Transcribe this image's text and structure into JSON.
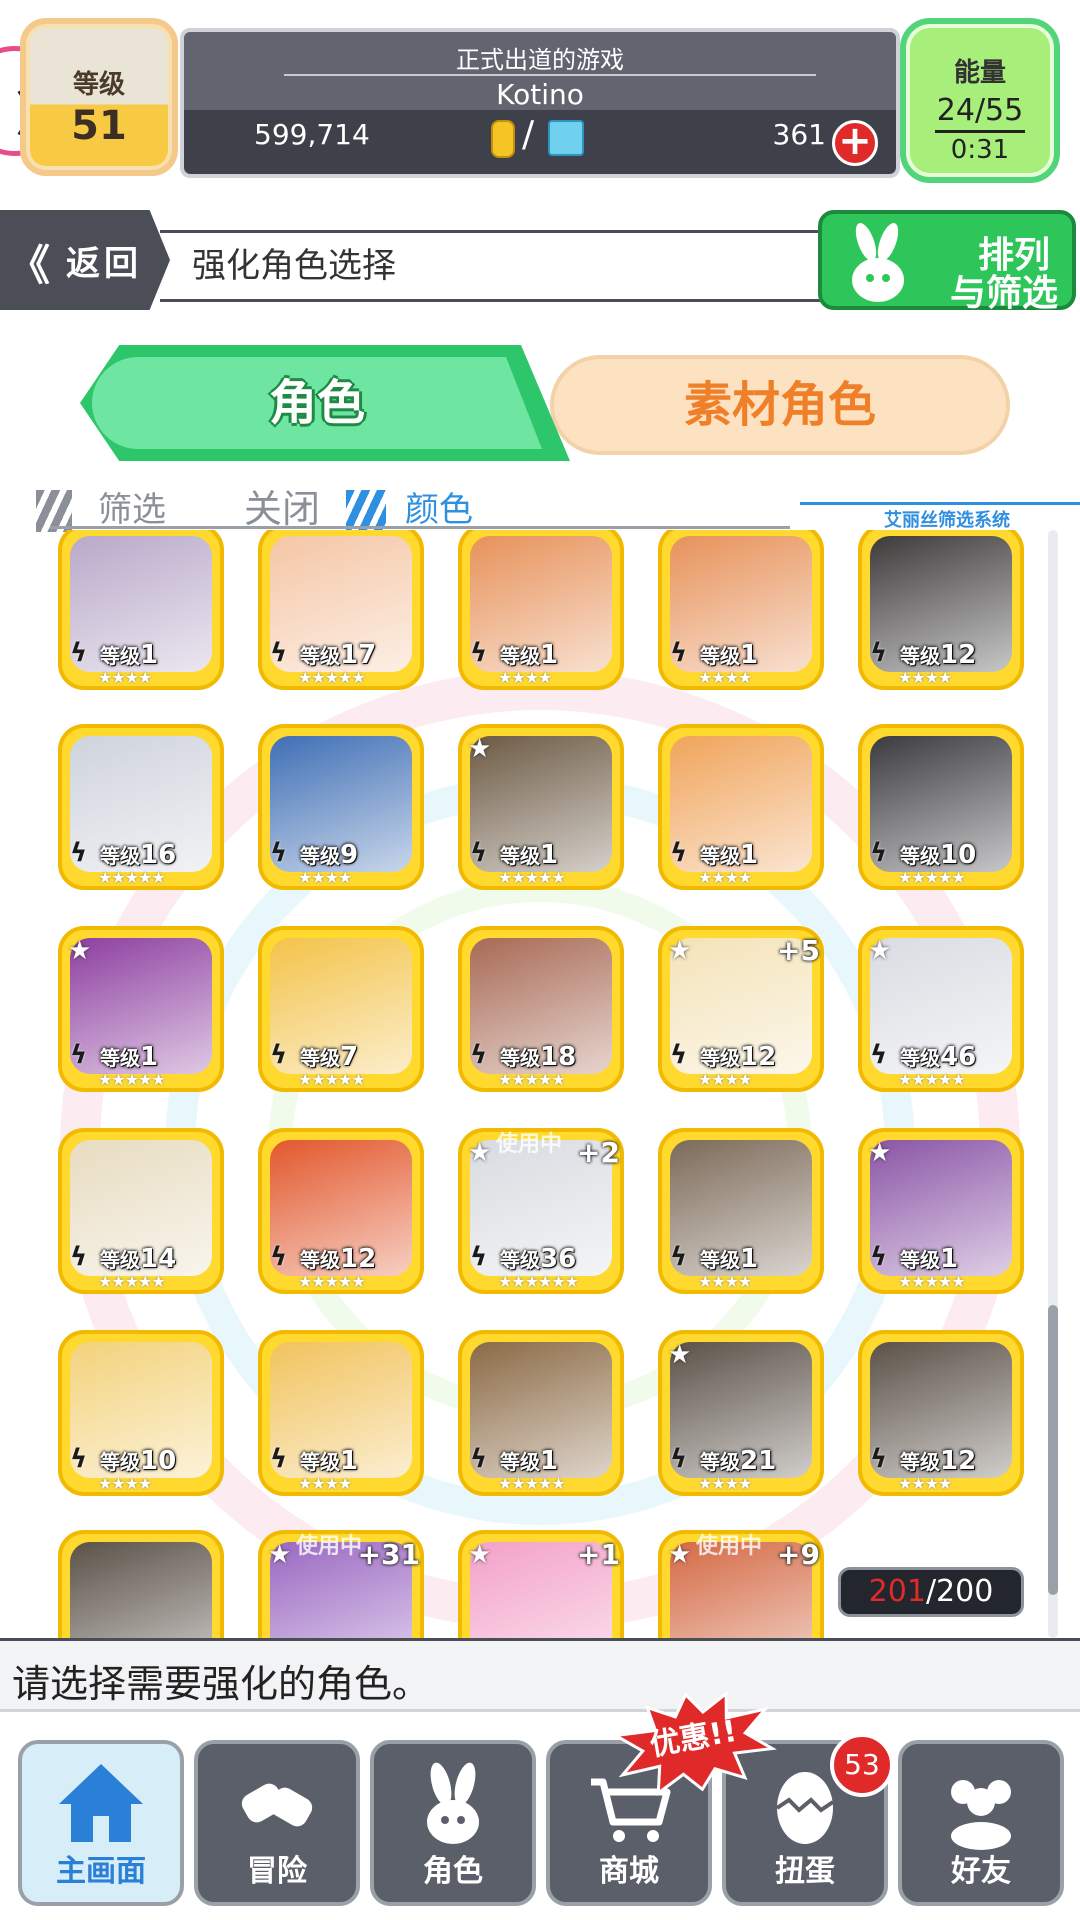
{
  "header": {
    "level_label": "等级",
    "level_value": "51",
    "subtitle": "正式出道的游戏",
    "player_name": "Kotino",
    "coins": "599,714",
    "slash": "/",
    "gems": "361",
    "plus": "+",
    "energy_label": "能量",
    "energy_value": "24/55",
    "energy_timer": "0:31"
  },
  "nav": {
    "back_label": "返回",
    "back_chevron": "《",
    "title": "强化角色选择",
    "sort_line1": "排列",
    "sort_line2": "与筛选"
  },
  "tabs": {
    "character": "角色",
    "material": "素材角色"
  },
  "filter": {
    "filter_label": "筛选",
    "off_label": "关闭",
    "color_label": "颜色",
    "system_label": "艾丽丝筛选系统"
  },
  "cards": [
    {
      "level_prefix": "等级",
      "level": "1",
      "stars": "★★★★",
      "color": "#b9a9c9",
      "star": "",
      "plus": "",
      "inuse": ""
    },
    {
      "level_prefix": "等级",
      "level": "17",
      "stars": "★★★★★",
      "color": "#f5c6a5",
      "star": "",
      "plus": "",
      "inuse": ""
    },
    {
      "level_prefix": "等级",
      "level": "1",
      "stars": "★★★★",
      "color": "#e7925a",
      "star": "",
      "plus": "",
      "inuse": ""
    },
    {
      "level_prefix": "等级",
      "level": "1",
      "stars": "★★★★",
      "color": "#e7925a",
      "star": "",
      "plus": "",
      "inuse": ""
    },
    {
      "level_prefix": "等级",
      "level": "12",
      "stars": "★★★★",
      "color": "#3d3a3a",
      "star": "",
      "plus": "",
      "inuse": ""
    },
    {
      "level_prefix": "等级",
      "level": "16",
      "stars": "★★★★★",
      "color": "#cfd3dc",
      "star": "",
      "plus": "",
      "inuse": ""
    },
    {
      "level_prefix": "等级",
      "level": "9",
      "stars": "★★★★",
      "color": "#3f6fb5",
      "star": "",
      "plus": "",
      "inuse": ""
    },
    {
      "level_prefix": "等级",
      "level": "1",
      "stars": "★★★★★",
      "color": "#6c5a44",
      "star": "★",
      "plus": "",
      "inuse": ""
    },
    {
      "level_prefix": "等级",
      "level": "1",
      "stars": "★★★★",
      "color": "#f0a45b",
      "star": "",
      "plus": "",
      "inuse": ""
    },
    {
      "level_prefix": "等级",
      "level": "10",
      "stars": "★★★★★",
      "color": "#3b3a3f",
      "star": "",
      "plus": "",
      "inuse": ""
    },
    {
      "level_prefix": "等级",
      "level": "1",
      "stars": "★★★★★",
      "color": "#8d3fa0",
      "star": "★",
      "plus": "",
      "inuse": ""
    },
    {
      "level_prefix": "等级",
      "level": "7",
      "stars": "★★★★★",
      "color": "#f3c34a",
      "star": "",
      "plus": "",
      "inuse": ""
    },
    {
      "level_prefix": "等级",
      "level": "18",
      "stars": "★★★★★",
      "color": "#a86a55",
      "star": "",
      "plus": "",
      "inuse": ""
    },
    {
      "level_prefix": "等级",
      "level": "12",
      "stars": "★★★★",
      "color": "#f4e3b8",
      "star": "★",
      "plus": "+5",
      "inuse": ""
    },
    {
      "level_prefix": "等级",
      "level": "46",
      "stars": "★★★★★",
      "color": "#d9dce2",
      "star": "★",
      "plus": "",
      "inuse": ""
    },
    {
      "level_prefix": "等级",
      "level": "14",
      "stars": "★★★★★",
      "color": "#e8dcc0",
      "star": "",
      "plus": "",
      "inuse": ""
    },
    {
      "level_prefix": "等级",
      "level": "12",
      "stars": "★★★★★",
      "color": "#e2572c",
      "star": "",
      "plus": "",
      "inuse": ""
    },
    {
      "level_prefix": "等级",
      "level": "36",
      "stars": "★★★★★★",
      "color": "#d8dbe0",
      "star": "★",
      "plus": "+2",
      "inuse": "使用中"
    },
    {
      "level_prefix": "等级",
      "level": "1",
      "stars": "★★★★",
      "color": "#7c6a58",
      "star": "",
      "plus": "",
      "inuse": ""
    },
    {
      "level_prefix": "等级",
      "level": "1",
      "stars": "★★★★★",
      "color": "#8a55a6",
      "star": "★",
      "plus": "",
      "inuse": ""
    },
    {
      "level_prefix": "等级",
      "level": "10",
      "stars": "★★★★",
      "color": "#f3d27b",
      "star": "",
      "plus": "",
      "inuse": ""
    },
    {
      "level_prefix": "等级",
      "level": "1",
      "stars": "★★★★",
      "color": "#f1c35d",
      "star": "",
      "plus": "",
      "inuse": ""
    },
    {
      "level_prefix": "等级",
      "level": "1",
      "stars": "★★★★★",
      "color": "#8b6a45",
      "star": "",
      "plus": "",
      "inuse": ""
    },
    {
      "level_prefix": "等级",
      "level": "21",
      "stars": "★★★★",
      "color": "#5b5148",
      "star": "★",
      "plus": "",
      "inuse": ""
    },
    {
      "level_prefix": "等级",
      "level": "12",
      "stars": "★★★★",
      "color": "#5b5148",
      "star": "",
      "plus": "",
      "inuse": ""
    },
    {
      "level_prefix": "",
      "level": "",
      "stars": "",
      "color": "#5b5148",
      "star": "",
      "plus": "",
      "inuse": ""
    },
    {
      "level_prefix": "",
      "level": "",
      "stars": "",
      "color": "#9a68c2",
      "star": "★",
      "plus": "+31",
      "inuse": "使用中"
    },
    {
      "level_prefix": "",
      "level": "",
      "stars": "",
      "color": "#f3a1c8",
      "star": "★",
      "plus": "+1",
      "inuse": ""
    },
    {
      "level_prefix": "",
      "level": "",
      "stars": "",
      "color": "#d46a45",
      "star": "★",
      "plus": "+9",
      "inuse": "使用中"
    }
  ],
  "count": {
    "current": "201",
    "max": "/200"
  },
  "message": "请选择需要强化的角色。",
  "bottom_nav": {
    "home": "主画面",
    "adventure": "冒险",
    "character": "角色",
    "shop": "商城",
    "gacha": "扭蛋",
    "friends": "好友",
    "sale": "优惠!!",
    "gacha_badge": "53"
  },
  "colors": {
    "accent_green": "#2ec66b",
    "card_yellow": "#ffd92e",
    "nav_dark": "#4b4e56",
    "alert_red": "#e02a2a",
    "filter_blue": "#2f8fe0"
  }
}
